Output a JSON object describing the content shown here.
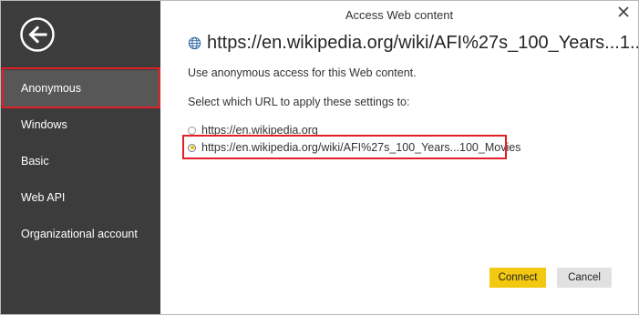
{
  "dialog": {
    "title": "Access Web content"
  },
  "sidebar": {
    "items": [
      {
        "label": "Anonymous",
        "active": true
      },
      {
        "label": "Windows",
        "active": false
      },
      {
        "label": "Basic",
        "active": false
      },
      {
        "label": "Web API",
        "active": false
      },
      {
        "label": "Organizational account",
        "active": false
      }
    ]
  },
  "main": {
    "url_heading": "https://en.wikipedia.org/wiki/AFI%27s_100_Years...1...",
    "description": "Use anonymous access for this Web content.",
    "select_prompt": "Select which URL to apply these settings to:",
    "url_options": [
      {
        "label": "https://en.wikipedia.org",
        "selected": false
      },
      {
        "label": "https://en.wikipedia.org/wiki/AFI%27s_100_Years...100_Movies",
        "selected": true
      }
    ]
  },
  "buttons": {
    "connect": "Connect",
    "cancel": "Cancel"
  },
  "colors": {
    "sidebar_bg": "#3c3c3c",
    "active_item_bg": "#575757",
    "highlight_outline": "#e01f26",
    "primary_button": "#f2c811"
  }
}
